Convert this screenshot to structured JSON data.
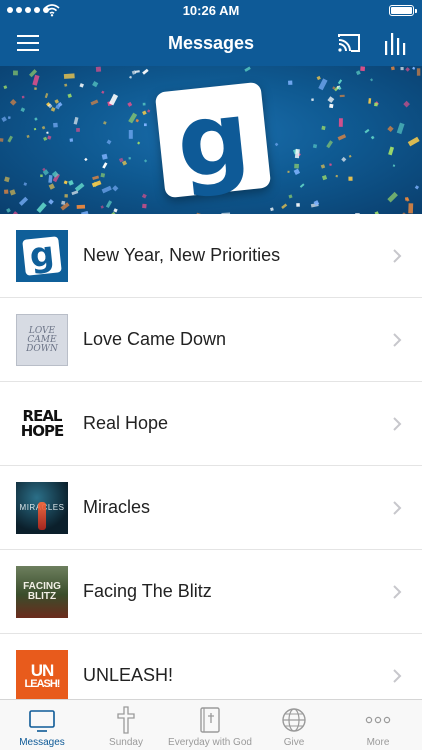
{
  "status_bar": {
    "time": "10:26 AM"
  },
  "nav": {
    "title": "Messages",
    "icons": [
      "menu-icon",
      "cast-icon",
      "equalizer-icon"
    ]
  },
  "banner": {
    "logo_letter": "g"
  },
  "list": {
    "items": [
      {
        "title": "New Year, New Priorities",
        "thumb_text": "g"
      },
      {
        "title": "Love Came Down",
        "thumb_lines": [
          "LOVE",
          "CAME",
          "DOWN"
        ]
      },
      {
        "title": "Real Hope",
        "thumb_lines": [
          "REAL",
          "HOPE"
        ]
      },
      {
        "title": "Miracles",
        "thumb_text": "MIRACLES"
      },
      {
        "title": "Facing The Blitz",
        "thumb_lines": [
          "FACING",
          "BLITZ"
        ]
      },
      {
        "title": "UNLEASH!",
        "thumb_lines": [
          "UN",
          "LEASH!"
        ]
      }
    ]
  },
  "tabbar": {
    "tabs": [
      {
        "label": "Messages",
        "icon": "monitor-icon",
        "active": true
      },
      {
        "label": "Sunday",
        "icon": "cross-icon",
        "active": false
      },
      {
        "label": "Everyday with God",
        "icon": "bible-icon",
        "active": false
      },
      {
        "label": "Give",
        "icon": "globe-icon",
        "active": false
      },
      {
        "label": "More",
        "icon": "more-icon",
        "active": false
      }
    ]
  },
  "colors": {
    "brand_blue": "#0e5a97",
    "active_tab": "#0e5a97",
    "inactive_tab": "#9a9a9a"
  }
}
